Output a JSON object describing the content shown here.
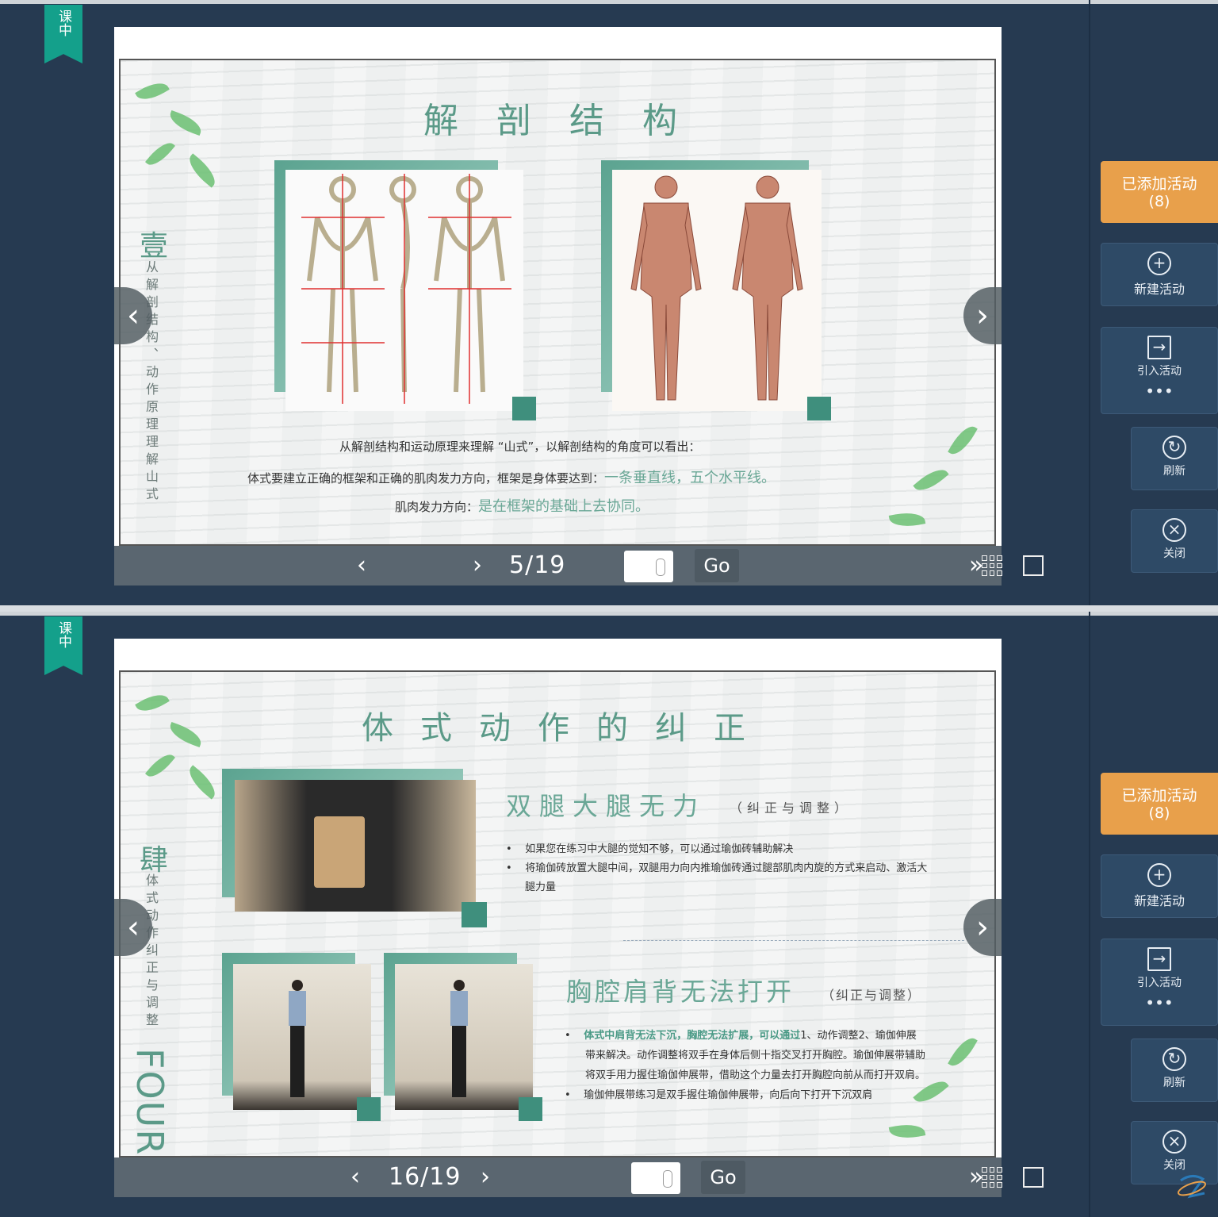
{
  "ribbon_label": "课中",
  "right_panel": {
    "added_activities": "已添加活动",
    "added_count": "(8)",
    "new_activity": "新建活动",
    "import_activity": "引入活动",
    "refresh": "刷新",
    "close": "关闭"
  },
  "nav": {
    "go": "Go",
    "prev": "‹",
    "next": "›",
    "side_prev": "‹",
    "side_next": "›",
    "end": "»"
  },
  "slide1": {
    "page": "5/19",
    "title": "解剖结构",
    "section_num": "壹",
    "section_text": "从解剖结构、动作原理理解山式",
    "line1": "从解剖结构和运动原理来理解 “山式”，以解剖结构的角度可以看出：",
    "line2_a": "体式要建立正确的框架和正确的肌肉发力方向，框架是身体要达到：",
    "line2_b": "一条垂直线，五个水平线。",
    "line3_a": "肌肉发力方向：",
    "line3_b": "是在框架的基础上去协同。"
  },
  "slide2": {
    "page": "16/19",
    "title": "体式动作的纠正",
    "section_num": "肆",
    "section_text": "体式动作纠正与调整",
    "section_en": "FOUR",
    "h1": "双腿大腿无力",
    "h1_sub": "（纠正与调整）",
    "b1": "如果您在练习中大腿的觉知不够，可以通过瑜伽砖辅助解决",
    "b2": "将瑜伽砖放置大腿中间，双腿用力向内推瑜伽砖通过腿部肌肉内旋的方式来启动、激活大腿力量",
    "h2": "胸腔肩背无法打开",
    "h2_sub": "（纠正与调整）",
    "b3_bold": "体式中肩背无法下沉，胸腔无法扩展，可以通过",
    "b3_rest": "1、动作调整2、瑜伽伸展带来解决。动作调整将双手在身体后侧十指交叉打开胸腔。瑜伽伸展带辅助将双手用力握住瑜伽伸展带，借助这个力量去打开胸腔向前从而打开双肩。",
    "b4": "瑜伽伸展带练习是双手握住瑜伽伸展带，向后向下打开下沉双肩"
  },
  "colors": {
    "accent": "#e8a04b",
    "teal": "#5b9a88",
    "panel": "#263a51"
  }
}
